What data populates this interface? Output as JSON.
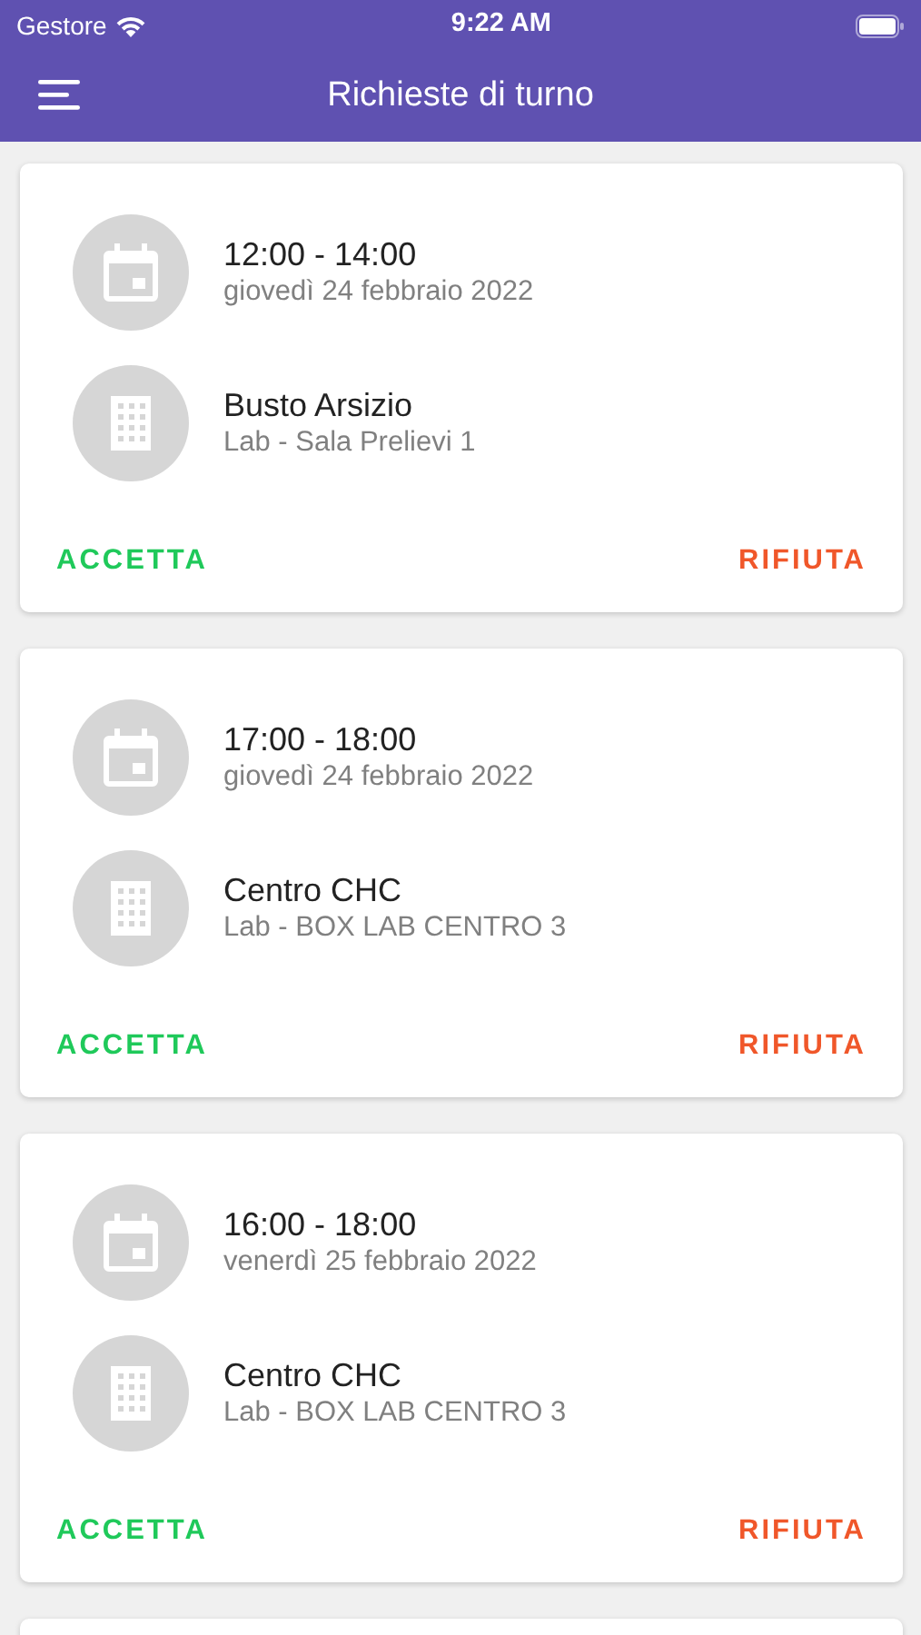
{
  "status_bar": {
    "carrier": "Gestore",
    "time": "9:22 AM"
  },
  "header": {
    "title": "Richieste di turno"
  },
  "requests": [
    {
      "time": "12:00 - 14:00",
      "date": "giovedì 24 febbraio 2022",
      "location": "Busto Arsizio",
      "room": "Lab - Sala Prelievi 1",
      "accept": "ACCETTA",
      "reject": "RIFIUTA"
    },
    {
      "time": "17:00 - 18:00",
      "date": "giovedì 24 febbraio 2022",
      "location": "Centro CHC",
      "room": "Lab - BOX LAB CENTRO 3",
      "accept": "ACCETTA",
      "reject": "RIFIUTA"
    },
    {
      "time": "16:00 - 18:00",
      "date": "venerdì 25 febbraio 2022",
      "location": "Centro CHC",
      "room": "Lab - BOX LAB CENTRO 3",
      "accept": "ACCETTA",
      "reject": "RIFIUTA"
    }
  ]
}
